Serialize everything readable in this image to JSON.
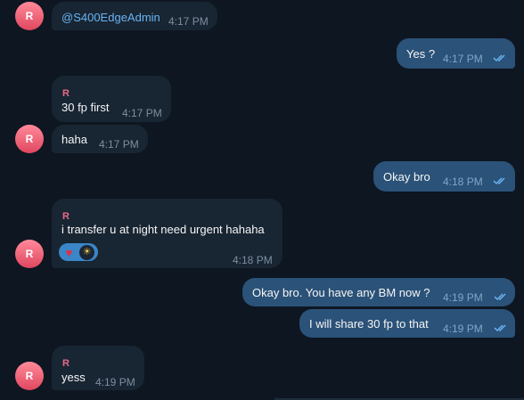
{
  "colors": {
    "background": "#0e1621",
    "incoming_bubble": "#182533",
    "outgoing_bubble": "#2b5278",
    "sender_name": "#e86a87",
    "avatar": "#e0475f",
    "mention": "#6ab3f3"
  },
  "messages": [
    {
      "dir": "in",
      "sender": "",
      "avatar": "R",
      "text": "@S400EdgeAdmin",
      "time": "4:17 PM"
    },
    {
      "dir": "out",
      "text": "Yes ?",
      "time": "4:17 PM",
      "read_icon": "double-check-icon"
    },
    {
      "dir": "in",
      "sender": "R",
      "text": "30 fp first",
      "time": "4:17 PM"
    },
    {
      "dir": "in",
      "avatar": "R",
      "text": "haha",
      "time": "4:17 PM"
    },
    {
      "dir": "out",
      "text": "Okay bro",
      "time": "4:18 PM",
      "read_icon": "double-check-icon"
    },
    {
      "dir": "in",
      "sender": "R",
      "avatar": "R",
      "text": "i transfer u at night need urgent hahaha",
      "time": "4:18 PM",
      "reactions": [
        {
          "icon": "heart-reaction-icon",
          "glyph": "♥"
        },
        {
          "icon": "sun-reaction-icon",
          "glyph": "☀"
        }
      ]
    },
    {
      "dir": "out",
      "text": "Okay bro. You have any BM now ?",
      "time": "4:19 PM",
      "read_icon": "double-check-icon"
    },
    {
      "dir": "out",
      "text": "I will share 30 fp to that",
      "time": "4:19 PM",
      "read_icon": "double-check-icon"
    },
    {
      "dir": "in",
      "sender": "R",
      "avatar": "R",
      "text": "yess",
      "time": "4:19 PM"
    }
  ]
}
